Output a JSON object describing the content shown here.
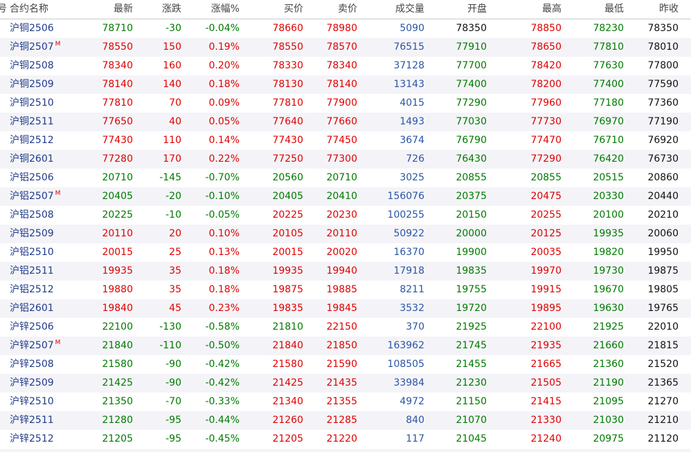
{
  "header": {
    "index": "号",
    "cols": [
      "合约名称",
      "最新",
      "涨跌",
      "涨幅%",
      "买价",
      "卖价",
      "成交量",
      "开盘",
      "最高",
      "最低",
      "昨收"
    ]
  },
  "colors": {
    "up": "#e00000",
    "down": "#007a00",
    "flat": "#111111",
    "name": "#1f3a8a",
    "volume": "#2a55a5"
  },
  "rows": [
    {
      "name": "沪铜2506",
      "main": "",
      "last": "78710",
      "chg": "-30",
      "pct": "-0.04%",
      "bid": "78660",
      "ask": "78980",
      "vol": "5090",
      "open": "78350",
      "high": "78850",
      "low": "78230",
      "prev": "78350"
    },
    {
      "name": "沪铜2507",
      "main": "M",
      "last": "78550",
      "chg": "150",
      "pct": "0.19%",
      "bid": "78550",
      "ask": "78570",
      "vol": "76515",
      "open": "77910",
      "high": "78650",
      "low": "77810",
      "prev": "78010"
    },
    {
      "name": "沪铜2508",
      "main": "",
      "last": "78340",
      "chg": "160",
      "pct": "0.20%",
      "bid": "78330",
      "ask": "78340",
      "vol": "37128",
      "open": "77700",
      "high": "78420",
      "low": "77630",
      "prev": "77800"
    },
    {
      "name": "沪铜2509",
      "main": "",
      "last": "78140",
      "chg": "140",
      "pct": "0.18%",
      "bid": "78130",
      "ask": "78140",
      "vol": "13143",
      "open": "77400",
      "high": "78200",
      "low": "77400",
      "prev": "77590"
    },
    {
      "name": "沪铜2510",
      "main": "",
      "last": "77810",
      "chg": "70",
      "pct": "0.09%",
      "bid": "77810",
      "ask": "77900",
      "vol": "4015",
      "open": "77290",
      "high": "77960",
      "low": "77180",
      "prev": "77360"
    },
    {
      "name": "沪铜2511",
      "main": "",
      "last": "77650",
      "chg": "40",
      "pct": "0.05%",
      "bid": "77640",
      "ask": "77660",
      "vol": "1493",
      "open": "77030",
      "high": "77730",
      "low": "76970",
      "prev": "77190"
    },
    {
      "name": "沪铜2512",
      "main": "",
      "last": "77430",
      "chg": "110",
      "pct": "0.14%",
      "bid": "77430",
      "ask": "77450",
      "vol": "3674",
      "open": "76790",
      "high": "77470",
      "low": "76710",
      "prev": "76920"
    },
    {
      "name": "沪铜2601",
      "main": "",
      "last": "77280",
      "chg": "170",
      "pct": "0.22%",
      "bid": "77250",
      "ask": "77300",
      "vol": "726",
      "open": "76430",
      "high": "77290",
      "low": "76420",
      "prev": "76730"
    },
    {
      "name": "沪铝2506",
      "main": "",
      "last": "20710",
      "chg": "-145",
      "pct": "-0.70%",
      "bid": "20560",
      "ask": "20710",
      "vol": "3025",
      "open": "20855",
      "high": "20855",
      "low": "20515",
      "prev": "20860"
    },
    {
      "name": "沪铝2507",
      "main": "M",
      "last": "20405",
      "chg": "-20",
      "pct": "-0.10%",
      "bid": "20405",
      "ask": "20410",
      "vol": "156076",
      "open": "20375",
      "high": "20475",
      "low": "20330",
      "prev": "20440"
    },
    {
      "name": "沪铝2508",
      "main": "",
      "last": "20225",
      "chg": "-10",
      "pct": "-0.05%",
      "bid": "20225",
      "ask": "20230",
      "vol": "100255",
      "open": "20150",
      "high": "20255",
      "low": "20100",
      "prev": "20210"
    },
    {
      "name": "沪铝2509",
      "main": "",
      "last": "20110",
      "chg": "20",
      "pct": "0.10%",
      "bid": "20105",
      "ask": "20110",
      "vol": "50922",
      "open": "20000",
      "high": "20125",
      "low": "19935",
      "prev": "20060"
    },
    {
      "name": "沪铝2510",
      "main": "",
      "last": "20015",
      "chg": "25",
      "pct": "0.13%",
      "bid": "20015",
      "ask": "20020",
      "vol": "16370",
      "open": "19900",
      "high": "20035",
      "low": "19820",
      "prev": "19950"
    },
    {
      "name": "沪铝2511",
      "main": "",
      "last": "19935",
      "chg": "35",
      "pct": "0.18%",
      "bid": "19935",
      "ask": "19940",
      "vol": "17918",
      "open": "19835",
      "high": "19970",
      "low": "19730",
      "prev": "19875"
    },
    {
      "name": "沪铝2512",
      "main": "",
      "last": "19880",
      "chg": "35",
      "pct": "0.18%",
      "bid": "19875",
      "ask": "19885",
      "vol": "8211",
      "open": "19755",
      "high": "19915",
      "low": "19670",
      "prev": "19805"
    },
    {
      "name": "沪铝2601",
      "main": "",
      "last": "19840",
      "chg": "45",
      "pct": "0.23%",
      "bid": "19835",
      "ask": "19845",
      "vol": "3532",
      "open": "19720",
      "high": "19895",
      "low": "19630",
      "prev": "19765"
    },
    {
      "name": "沪锌2506",
      "main": "",
      "last": "22100",
      "chg": "-130",
      "pct": "-0.58%",
      "bid": "21810",
      "ask": "22150",
      "vol": "370",
      "open": "21925",
      "high": "22100",
      "low": "21925",
      "prev": "22010"
    },
    {
      "name": "沪锌2507",
      "main": "M",
      "last": "21840",
      "chg": "-110",
      "pct": "-0.50%",
      "bid": "21840",
      "ask": "21850",
      "vol": "163962",
      "open": "21745",
      "high": "21935",
      "low": "21660",
      "prev": "21815"
    },
    {
      "name": "沪锌2508",
      "main": "",
      "last": "21580",
      "chg": "-90",
      "pct": "-0.42%",
      "bid": "21580",
      "ask": "21590",
      "vol": "108505",
      "open": "21455",
      "high": "21665",
      "low": "21360",
      "prev": "21520"
    },
    {
      "name": "沪锌2509",
      "main": "",
      "last": "21425",
      "chg": "-90",
      "pct": "-0.42%",
      "bid": "21425",
      "ask": "21435",
      "vol": "33984",
      "open": "21230",
      "high": "21505",
      "low": "21190",
      "prev": "21365"
    },
    {
      "name": "沪锌2510",
      "main": "",
      "last": "21350",
      "chg": "-70",
      "pct": "-0.33%",
      "bid": "21340",
      "ask": "21355",
      "vol": "4972",
      "open": "21150",
      "high": "21415",
      "low": "21095",
      "prev": "21270"
    },
    {
      "name": "沪锌2511",
      "main": "",
      "last": "21280",
      "chg": "-95",
      "pct": "-0.44%",
      "bid": "21260",
      "ask": "21285",
      "vol": "840",
      "open": "21070",
      "high": "21330",
      "low": "21030",
      "prev": "21210"
    },
    {
      "name": "沪锌2512",
      "main": "",
      "last": "21205",
      "chg": "-95",
      "pct": "-0.45%",
      "bid": "21205",
      "ask": "21220",
      "vol": "117",
      "open": "21045",
      "high": "21240",
      "low": "20975",
      "prev": "21120"
    }
  ]
}
